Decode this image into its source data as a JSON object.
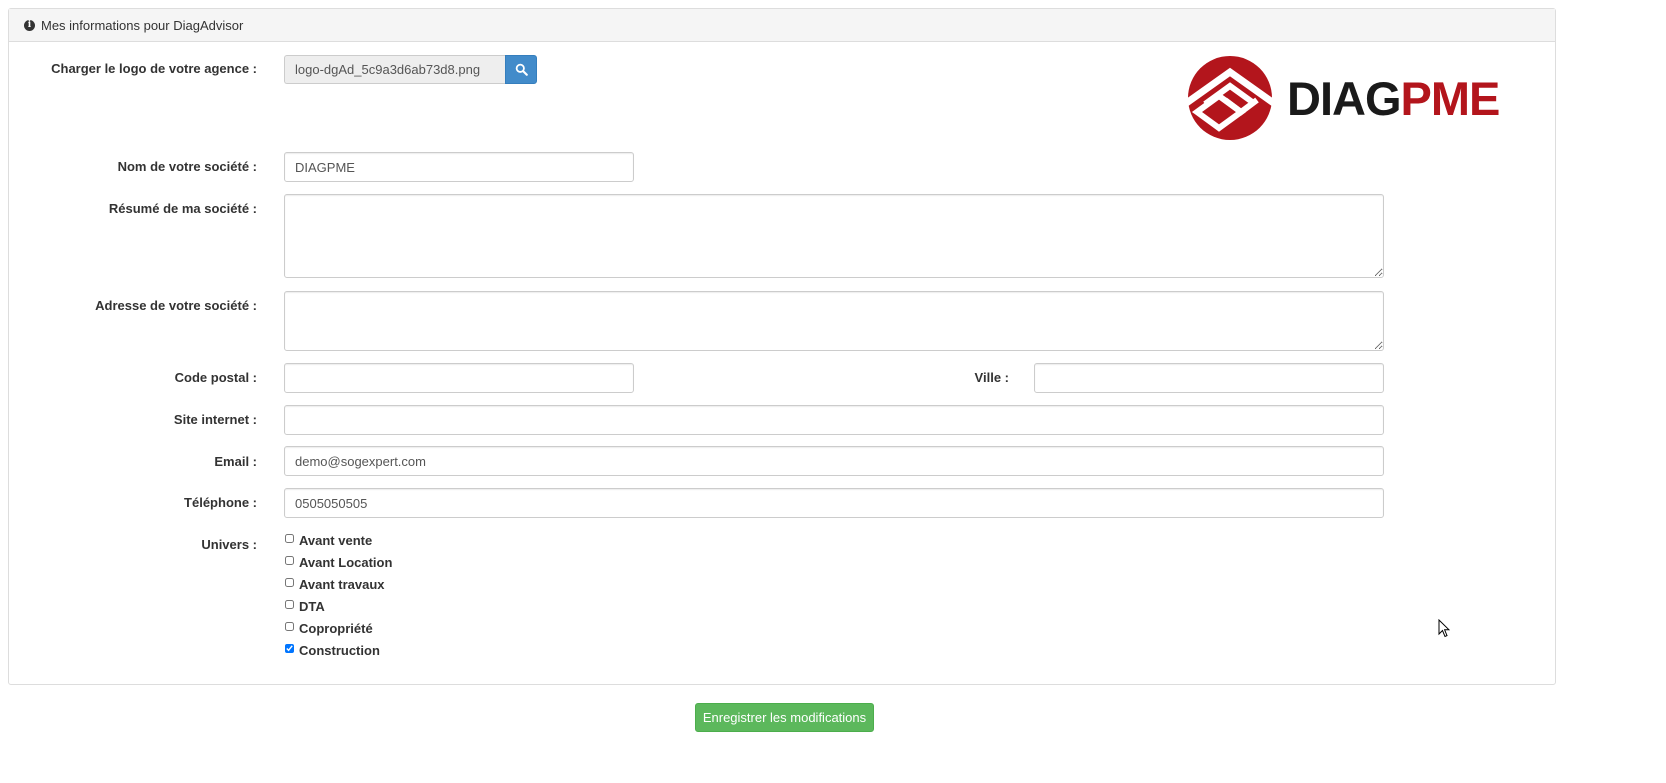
{
  "panel": {
    "title": "Mes informations pour DiagAdvisor",
    "icon": "info-circle-icon"
  },
  "logo_upload": {
    "label": "Charger le logo de votre agence :",
    "filename": "logo-dgAd_5c9a3d6ab73d8.png",
    "browse_icon": "search-icon",
    "browse_color": "#428bca"
  },
  "logo": {
    "part1": "DIAG",
    "part2": "PME",
    "brand_dark": "#1a1a1a",
    "brand_red": "#b3151c"
  },
  "form": {
    "company_name": {
      "label": "Nom de votre société :",
      "value": "DIAGPME"
    },
    "summary": {
      "label": "Résumé de ma société :",
      "value": ""
    },
    "address": {
      "label": "Adresse de votre société :",
      "value": ""
    },
    "postal_code": {
      "label": "Code postal :",
      "value": ""
    },
    "city": {
      "label": "Ville :",
      "value": ""
    },
    "website": {
      "label": "Site internet :",
      "value": ""
    },
    "email": {
      "label": "Email :",
      "value": "demo@sogexpert.com"
    },
    "phone": {
      "label": "Téléphone :",
      "value": "0505050505"
    },
    "universes": {
      "label": "Univers :",
      "options": [
        {
          "label": "Avant vente",
          "checked": false
        },
        {
          "label": "Avant Location",
          "checked": false
        },
        {
          "label": "Avant travaux",
          "checked": false
        },
        {
          "label": "DTA",
          "checked": false
        },
        {
          "label": "Copropriété",
          "checked": false
        },
        {
          "label": "Construction",
          "checked": true
        }
      ]
    }
  },
  "actions": {
    "save_label": "Enregistrer les modifications",
    "save_color": "#5cb85c"
  }
}
